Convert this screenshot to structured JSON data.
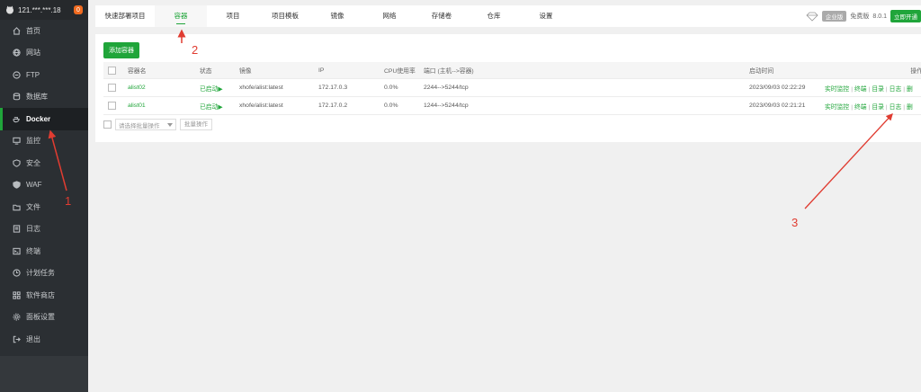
{
  "sidebar": {
    "server": "121.***.***.18",
    "badge": "0",
    "items": [
      {
        "label": "首页",
        "icon": "home-icon"
      },
      {
        "label": "网站",
        "icon": "globe-icon"
      },
      {
        "label": "FTP",
        "icon": "ftp-icon"
      },
      {
        "label": "数据库",
        "icon": "database-icon"
      },
      {
        "label": "Docker",
        "icon": "docker-icon",
        "active": true
      },
      {
        "label": "监控",
        "icon": "monitor-icon"
      },
      {
        "label": "安全",
        "icon": "shield-icon"
      },
      {
        "label": "WAF",
        "icon": "waf-icon"
      },
      {
        "label": "文件",
        "icon": "folder-icon"
      },
      {
        "label": "日志",
        "icon": "log-icon"
      },
      {
        "label": "终端",
        "icon": "terminal-icon"
      },
      {
        "label": "计划任务",
        "icon": "clock-icon"
      },
      {
        "label": "软件商店",
        "icon": "grid-icon"
      },
      {
        "label": "面板设置",
        "icon": "gear-icon"
      },
      {
        "label": "退出",
        "icon": "logout-icon"
      }
    ]
  },
  "tabs": [
    "快速部署项目",
    "容器",
    "项目",
    "项目模板",
    "镜像",
    "网络",
    "存储卷",
    "仓库",
    "设置"
  ],
  "header_right": {
    "edition": "企业版",
    "free": "免费版",
    "version": "8.0.1",
    "buy": "立即开通"
  },
  "toolbar": {
    "add_label": "添加容器"
  },
  "table": {
    "headers": [
      "容器名",
      "状态",
      "镜像",
      "IP",
      "CPU使用率",
      "端口 (主机-->容器)",
      "启动时间",
      "操作"
    ],
    "rows": [
      {
        "name": "alist02",
        "status": "已启动",
        "image": "xhofe/alist:latest",
        "ip": "172.17.0.3",
        "cpu": "0.0%",
        "port": "2244-->5244/tcp",
        "time": "2023/09/03 02:22:29"
      },
      {
        "name": "alist01",
        "status": "已启动",
        "image": "xhofe/alist:latest",
        "ip": "172.17.0.2",
        "cpu": "0.0%",
        "port": "1244-->5244/tcp",
        "time": "2023/09/03 02:21:21"
      }
    ],
    "actions": [
      "实时监控",
      "终端",
      "目录",
      "日志",
      "删"
    ]
  },
  "batch": {
    "placeholder": "请选择批量操作",
    "button": "批量操作"
  },
  "annotations": [
    "1",
    "2",
    "3"
  ],
  "colors": {
    "accent": "#20a53a",
    "annotation": "#e03c31",
    "sidebar": "#2b2f33"
  }
}
